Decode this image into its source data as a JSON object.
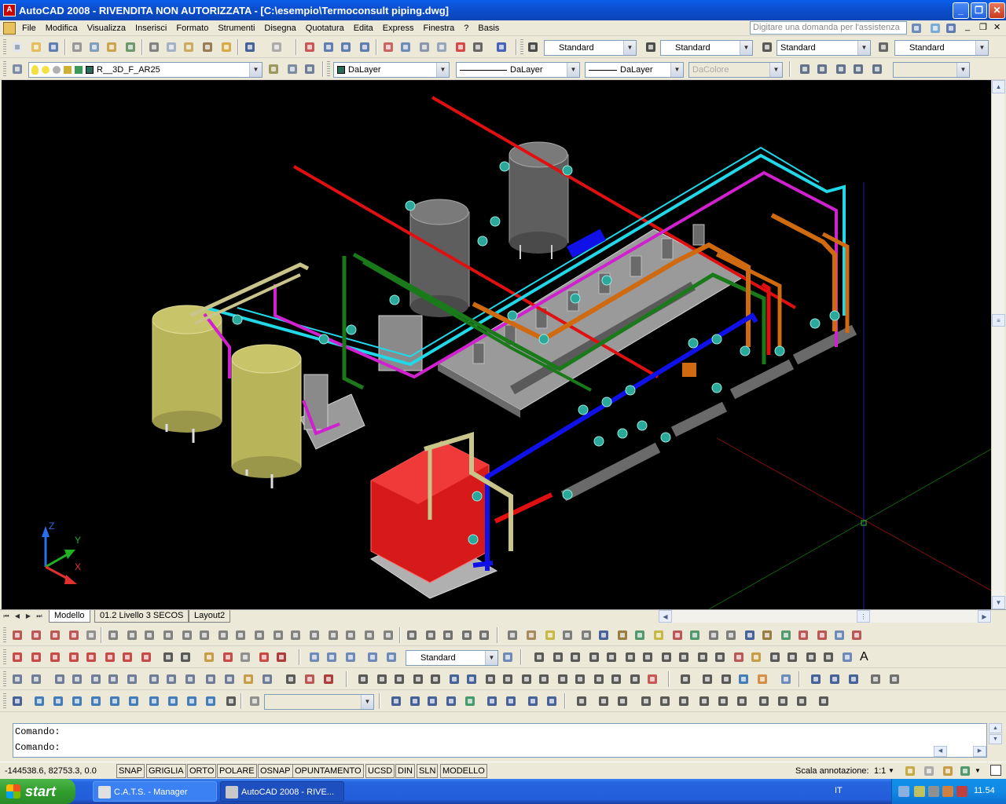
{
  "window": {
    "app_icon_letter": "A",
    "title": "AutoCAD 2008 - RIVENDITA NON AUTORIZZATA - [C:\\esempio\\Termoconsult piping.dwg]",
    "controls": {
      "minimize": "_",
      "maximize": "❐",
      "close": "✕"
    }
  },
  "menubar": {
    "items": [
      "File",
      "Modifica",
      "Visualizza",
      "Inserisci",
      "Formato",
      "Strumenti",
      "Disegna",
      "Quotatura",
      "Edita",
      "Express",
      "Finestra",
      "?",
      "Basis"
    ],
    "help_placeholder": "Digitare una domanda per l'assistenza",
    "doc_controls": {
      "minimize": "_",
      "restore": "❐",
      "close": "✕"
    }
  },
  "toolbar_styles": {
    "text_style": "Standard",
    "dim_style": "Standard",
    "table_style": "Standard",
    "multileader_style": "Standard"
  },
  "toolbar_layers": {
    "current_layer": "R__3D_F_AR25",
    "color": "DaLayer",
    "linetype": "DaLayer",
    "lineweight": "DaLayer",
    "plot_style": "DaColore"
  },
  "tabs": {
    "items": [
      "Modello",
      "01.2 Livello 3 SECOS",
      "Layout2"
    ],
    "active": "Modello"
  },
  "lower_toolbar": {
    "style_combo": "Standard",
    "text_icon": "A"
  },
  "ucs_icon": {
    "x_label": "X",
    "y_label": "Y",
    "z_label": "Z"
  },
  "command": {
    "lines": [
      "Comando:",
      "Comando:"
    ]
  },
  "status": {
    "coords": "-144538.6, 82753.3, 0.0",
    "toggles": [
      "SNAP",
      "GRIGLIA",
      "ORTO",
      "POLARE",
      "OSNAP",
      "OPUNTAMENTO",
      "UCSD",
      "DIN",
      "SLN",
      "MODELLO"
    ],
    "annotation_scale_label": "Scala annotazione:",
    "annotation_scale_value": "1:1"
  },
  "taskbar": {
    "start_label": "start",
    "buttons": [
      {
        "label": "C.A.T.S. - Manager",
        "icon": "cats-icon"
      },
      {
        "label": "AutoCAD 2008 - RIVE...",
        "icon": "autocad-icon"
      }
    ],
    "language": "IT",
    "clock": "11.54"
  },
  "colors": {
    "viewport_bg": "#000000",
    "pipe_red": "#e01010",
    "pipe_cyan": "#20d8e8",
    "pipe_magenta": "#d020d0",
    "pipe_blue": "#1010e8",
    "pipe_orange": "#d06a10",
    "pipe_green": "#1a7a1a",
    "tank_yellow": "#b8b45a",
    "tank_grey": "#5a5a5a",
    "boiler_red": "#d61a1a"
  }
}
